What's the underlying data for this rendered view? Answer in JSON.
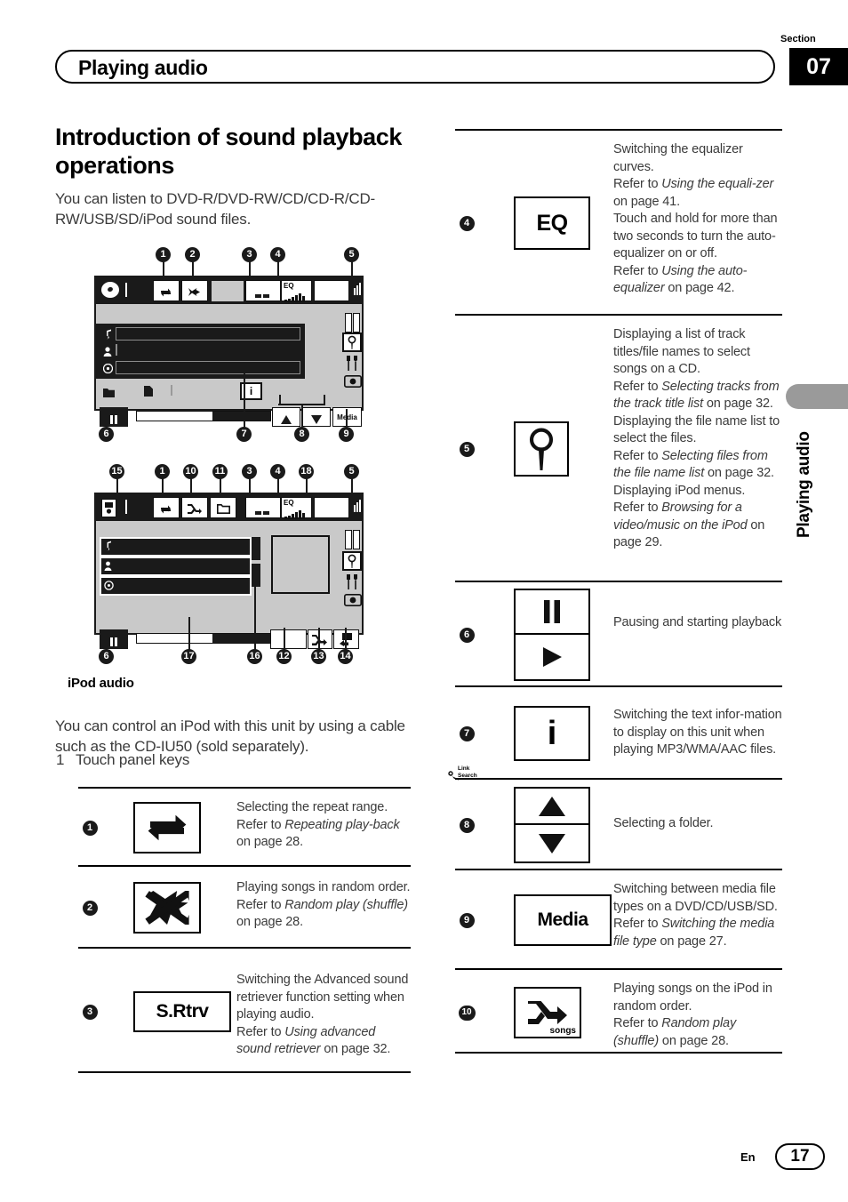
{
  "header": {
    "title": "Playing audio",
    "section_label": "Section",
    "section_number": "07"
  },
  "side_tab": {
    "label": "Playing audio"
  },
  "footer": {
    "language": "En",
    "page_number": "17"
  },
  "left_column": {
    "heading": "Introduction of sound playback operations",
    "intro": "You can listen to DVD-R/DVD-RW/CD/CD-R/CD-RW/USB/SD/iPod sound files.",
    "illustration_1": {
      "name": "disc-audio-screen",
      "eq_label": "EQ",
      "info_label": "i",
      "media_label": "Media",
      "callouts_top": [
        "1",
        "2",
        "3",
        "4",
        "5"
      ],
      "callouts_bottom": [
        "6",
        "7",
        "8",
        "9"
      ]
    },
    "illustration_2": {
      "name": "ipod-audio-screen",
      "eq_label": "EQ",
      "link_search_label_1": "Link",
      "link_search_label_2": "Search",
      "callouts_top": [
        "15",
        "1",
        "10",
        "11",
        "3",
        "4",
        "18",
        "5"
      ],
      "callouts_bottom": [
        "6",
        "17",
        "16",
        "12",
        "13",
        "14"
      ]
    },
    "ipod_caption": "iPod audio",
    "ipod_text": "You can control an iPod with this unit by using a cable such as the CD-IU50 (sold separately).",
    "list_marker": "1",
    "list_text": "Touch panel keys"
  },
  "key_table_left": [
    {
      "number": "1",
      "icon": "repeat-icon",
      "icon_text": "",
      "lines": [
        {
          "segments": [
            {
              "t": "Selecting the repeat range.",
              "i": false
            }
          ]
        },
        {
          "segments": [
            {
              "t": "Refer to ",
              "i": false
            },
            {
              "t": "Repeating play-back",
              "i": true
            },
            {
              "t": " on page 28.",
              "i": false
            }
          ]
        }
      ]
    },
    {
      "number": "2",
      "icon": "shuffle-icon",
      "icon_text": "",
      "lines": [
        {
          "segments": [
            {
              "t": "Playing songs in random order.",
              "i": false
            }
          ]
        },
        {
          "segments": [
            {
              "t": "Refer to ",
              "i": false
            },
            {
              "t": "Random play (shuffle)",
              "i": true
            },
            {
              "t": " on page 28.",
              "i": false
            }
          ]
        }
      ]
    },
    {
      "number": "3",
      "icon": "text-icon",
      "icon_text": "S.Rtrv",
      "lines": [
        {
          "segments": [
            {
              "t": "Switching the Advanced sound retriever function setting when playing audio.",
              "i": false
            }
          ]
        },
        {
          "segments": [
            {
              "t": "Refer to ",
              "i": false
            },
            {
              "t": "Using advanced sound retriever",
              "i": true
            },
            {
              "t": " on page 32.",
              "i": false
            }
          ]
        }
      ]
    }
  ],
  "key_table_right": [
    {
      "number": "4",
      "icon": "text-icon",
      "icon_text": "EQ",
      "lines": [
        {
          "segments": [
            {
              "t": "Switching the equalizer curves.",
              "i": false
            }
          ]
        },
        {
          "segments": [
            {
              "t": "Refer to ",
              "i": false
            },
            {
              "t": "Using the equali-zer",
              "i": true
            },
            {
              "t": " on page 41.",
              "i": false
            }
          ]
        },
        {
          "segments": [
            {
              "t": "Touch and hold for more than two seconds to turn the auto-equalizer on or off.",
              "i": false
            }
          ]
        },
        {
          "segments": [
            {
              "t": "Refer to ",
              "i": false
            },
            {
              "t": "Using the auto-equalizer",
              "i": true
            },
            {
              "t": " on page 42.",
              "i": false
            }
          ]
        }
      ]
    },
    {
      "number": "5",
      "icon": "magnifier-icon",
      "icon_text": "",
      "lines": [
        {
          "segments": [
            {
              "t": "Displaying a list of track titles/file names to select songs on a CD.",
              "i": false
            }
          ]
        },
        {
          "segments": [
            {
              "t": "Refer to ",
              "i": false
            },
            {
              "t": "Selecting tracks from the track title list",
              "i": true
            },
            {
              "t": " on page 32.",
              "i": false
            }
          ]
        },
        {
          "segments": [
            {
              "t": "Displaying the file name list to select the files.",
              "i": false
            }
          ]
        },
        {
          "segments": [
            {
              "t": "Refer to ",
              "i": false
            },
            {
              "t": "Selecting files from the file name list",
              "i": true
            },
            {
              "t": " on page 32.",
              "i": false
            }
          ]
        },
        {
          "segments": [
            {
              "t": "Displaying iPod menus.",
              "i": false
            }
          ]
        },
        {
          "segments": [
            {
              "t": "Refer to ",
              "i": false
            },
            {
              "t": "Browsing for a video/music on the iPod",
              "i": true
            },
            {
              "t": " on page 29.",
              "i": false
            }
          ]
        }
      ]
    },
    {
      "number": "6",
      "icon": "pause-play-icon",
      "icon_text": "",
      "lines": [
        {
          "segments": [
            {
              "t": "Pausing and starting playback",
              "i": false
            }
          ]
        }
      ]
    },
    {
      "number": "7",
      "icon": "info-icon",
      "icon_text": "i",
      "lines": [
        {
          "segments": [
            {
              "t": "Switching the text infor-mation to display on this unit when playing MP3/WMA/AAC files.",
              "i": false
            }
          ]
        }
      ]
    },
    {
      "number": "8",
      "icon": "up-down-arrow-icon",
      "icon_text": "",
      "lines": [
        {
          "segments": [
            {
              "t": "Selecting a folder.",
              "i": false
            }
          ]
        }
      ]
    },
    {
      "number": "9",
      "icon": "text-icon",
      "icon_text": "Media",
      "lines": [
        {
          "segments": [
            {
              "t": "Switching between media file types on a DVD/CD/USB/SD.",
              "i": false
            }
          ]
        },
        {
          "segments": [
            {
              "t": "Refer to ",
              "i": false
            },
            {
              "t": "Switching the media file type",
              "i": true
            },
            {
              "t": " on page 27.",
              "i": false
            }
          ]
        }
      ]
    },
    {
      "number": "10",
      "icon": "shuffle-songs-icon",
      "icon_text": "songs",
      "lines": [
        {
          "segments": [
            {
              "t": "Playing songs on the iPod in random order.",
              "i": false
            }
          ]
        },
        {
          "segments": [
            {
              "t": "Refer to ",
              "i": false
            },
            {
              "t": "Random play (shuffle)",
              "i": true
            },
            {
              "t": " on page 28.",
              "i": false
            }
          ]
        }
      ]
    }
  ]
}
